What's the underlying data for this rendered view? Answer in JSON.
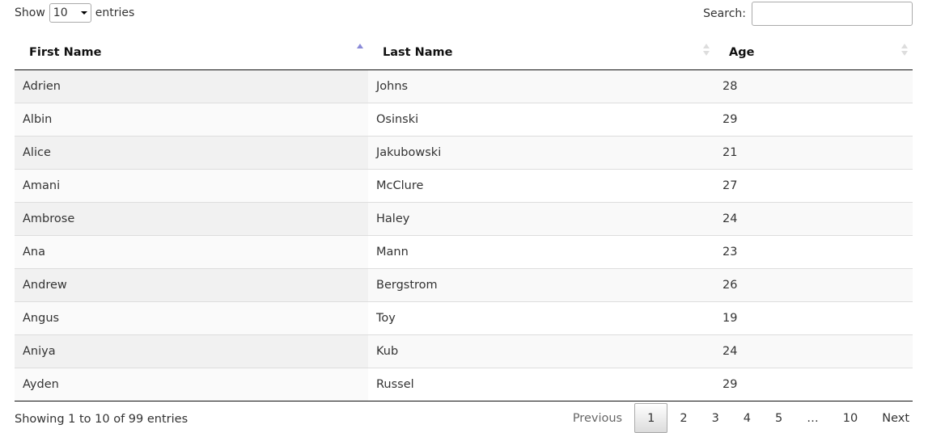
{
  "length": {
    "show_label": "Show",
    "value": "10",
    "entries_label": "entries"
  },
  "search": {
    "label": "Search:",
    "value": "",
    "placeholder": ""
  },
  "columns": [
    {
      "label": "First Name",
      "sort": "asc"
    },
    {
      "label": "Last Name",
      "sort": "none"
    },
    {
      "label": "Age",
      "sort": "none"
    }
  ],
  "rows": [
    [
      "Adrien",
      "Johns",
      "28"
    ],
    [
      "Albin",
      "Osinski",
      "29"
    ],
    [
      "Alice",
      "Jakubowski",
      "21"
    ],
    [
      "Amani",
      "McClure",
      "27"
    ],
    [
      "Ambrose",
      "Haley",
      "24"
    ],
    [
      "Ana",
      "Mann",
      "23"
    ],
    [
      "Andrew",
      "Bergstrom",
      "26"
    ],
    [
      "Angus",
      "Toy",
      "19"
    ],
    [
      "Aniya",
      "Kub",
      "24"
    ],
    [
      "Ayden",
      "Russel",
      "29"
    ]
  ],
  "info": "Showing 1 to 10 of 99 entries",
  "pagination": {
    "previous": "Previous",
    "pages": [
      "1",
      "2",
      "3",
      "4",
      "5",
      "…",
      "10"
    ],
    "current": "1",
    "next": "Next"
  }
}
